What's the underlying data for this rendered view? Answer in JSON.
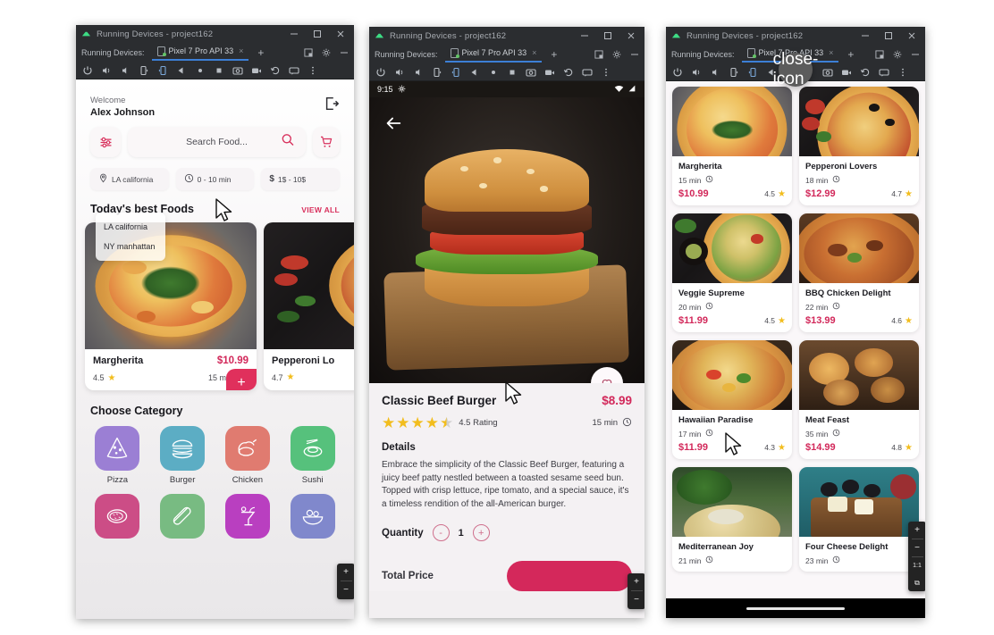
{
  "ide": {
    "window_title": "Running Devices - project162",
    "tab_group_label": "Running Devices:",
    "device_tab": "Pixel 7 Pro API 33",
    "tab_close": "×",
    "new_tab": "+",
    "minimize": "−",
    "maximize": "□",
    "close": "×",
    "toolbar_icons": [
      "power-icon",
      "volume-up-icon",
      "volume-down-icon",
      "rotate-left-icon",
      "rotate-right-icon",
      "back-icon",
      "home-icon",
      "overview-icon",
      "screenshot-icon",
      "record-icon",
      "history-icon",
      "feedback-icon",
      "more-icon"
    ]
  },
  "phone1": {
    "welcome_label": "Welcome",
    "user_name": "Alex Johnson",
    "logout_icon": "logout-icon",
    "search": {
      "placeholder": "Search Food...",
      "icon": "search-icon"
    },
    "filter_icon": "sliders-icon",
    "cart_icon": "cart-icon",
    "chips": [
      {
        "icon": "location-pin-icon",
        "label": "LA california"
      },
      {
        "icon": "clock-icon",
        "label": "0 - 10 min"
      },
      {
        "icon": "dollar-icon",
        "label": "1$ - 10$"
      }
    ],
    "location_dropdown": {
      "open": true,
      "options": [
        "LA california",
        "NY manhattan"
      ]
    },
    "section_title": "Today's best Foods",
    "view_all": "VIEW ALL",
    "foods": [
      {
        "name": "Margherita",
        "price": "$10.99",
        "rating": "4.5",
        "time": "15 min",
        "add": "+"
      },
      {
        "name": "Pepperoni Lo",
        "price": "",
        "rating": "4.7",
        "time": "",
        "add": "+"
      }
    ],
    "category_title": "Choose Category",
    "categories": [
      {
        "label": "Pizza",
        "icon": "pizza-slice-icon",
        "color": "#9b7fd4"
      },
      {
        "label": "Burger",
        "icon": "burger-icon",
        "color": "#5cadc4"
      },
      {
        "label": "Chicken",
        "icon": "chicken-leg-icon",
        "color": "#e07b70"
      },
      {
        "label": "Sushi",
        "icon": "sushi-icon",
        "color": "#56c17c"
      },
      {
        "label": "",
        "icon": "steak-icon",
        "color": "#cc4d86"
      },
      {
        "label": "",
        "icon": "hotdog-icon",
        "color": "#78bb82"
      },
      {
        "label": "",
        "icon": "drink-icon",
        "color": "#b93fc0"
      },
      {
        "label": "",
        "icon": "salad-icon",
        "color": "#8088cc"
      }
    ]
  },
  "phone2": {
    "status_time": "9:15",
    "status_icons": [
      "gear-icon",
      "wifi-icon",
      "signal-icon"
    ],
    "back_icon": "back-arrow-icon",
    "favorite_icon": "heart-icon",
    "title": "Classic Beef Burger",
    "price": "$8.99",
    "rating_value": "4.5 Rating",
    "stars": 4.5,
    "time": "15 min",
    "clock_icon": "clock-icon",
    "details_heading": "Details",
    "description": "Embrace the simplicity of the Classic Beef Burger, featuring a juicy beef patty nestled between a toasted sesame seed bun. Topped with crisp lettuce, ripe tomato, and a special sauce, it's a timeless rendition of the all-American burger.",
    "quantity_label": "Quantity",
    "quantity_value": "1",
    "decrement": "-",
    "increment": "+",
    "total_label": "Total Price"
  },
  "phone3": {
    "close_overlay_icon": "close-icon",
    "items": [
      {
        "name": "Margherita",
        "time": "15 min",
        "price": "$10.99",
        "rating": "4.5"
      },
      {
        "name": "Pepperoni Lovers",
        "time": "18 min",
        "price": "$12.99",
        "rating": "4.7"
      },
      {
        "name": "Veggie Supreme",
        "time": "20 min",
        "price": "$11.99",
        "rating": "4.5"
      },
      {
        "name": "BBQ Chicken Delight",
        "time": "22 min",
        "price": "$13.99",
        "rating": "4.6"
      },
      {
        "name": "Hawaiian Paradise",
        "time": "17 min",
        "price": "$11.99",
        "rating": "4.3"
      },
      {
        "name": "Meat Feast",
        "time": "35 min",
        "price": "$14.99",
        "rating": "4.8"
      },
      {
        "name": "Mediterranean Joy",
        "time": "21 min",
        "price": "",
        "rating": ""
      },
      {
        "name": "Four Cheese Delight",
        "time": "23 min",
        "price": "",
        "rating": ""
      }
    ]
  },
  "zoom_widget": {
    "plus": "+",
    "minus": "−",
    "actual": "1:1",
    "fit": "⧉"
  },
  "colors": {
    "accent": "#d2285a",
    "star": "#f2bd1d",
    "ide_chrome": "#2b2d30",
    "tab_underline": "#3c7fd6"
  }
}
